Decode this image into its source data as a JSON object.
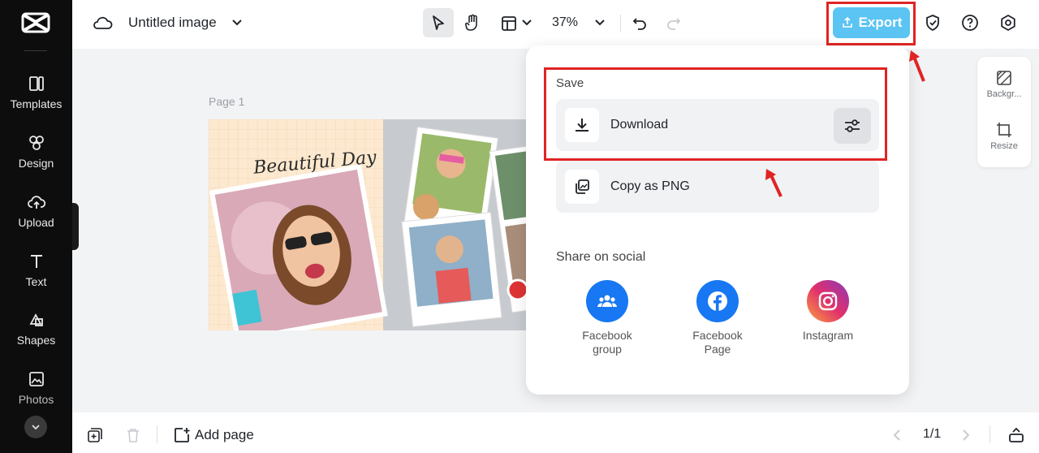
{
  "topbar": {
    "doc_title": "Untitled image",
    "zoom": "37%",
    "export_label": "Export"
  },
  "sidebar": {
    "items": [
      {
        "label": "Templates",
        "icon": "templates-icon"
      },
      {
        "label": "Design",
        "icon": "design-icon"
      },
      {
        "label": "Upload",
        "icon": "upload-cloud-icon"
      },
      {
        "label": "Text",
        "icon": "text-icon"
      },
      {
        "label": "Shapes",
        "icon": "shapes-icon"
      },
      {
        "label": "Photos",
        "icon": "photos-icon"
      }
    ]
  },
  "canvas": {
    "page_label": "Page 1",
    "artwork_text": "Beautiful Day"
  },
  "right_panel": {
    "items": [
      {
        "label": "Backgr...",
        "icon": "background-icon"
      },
      {
        "label": "Resize",
        "icon": "resize-icon"
      }
    ]
  },
  "export_menu": {
    "save_label": "Save",
    "download_label": "Download",
    "copy_label": "Copy as PNG",
    "share_label": "Share on social",
    "social": [
      {
        "label": "Facebook group",
        "color": "#1877f2",
        "icon": "facebook-group-icon"
      },
      {
        "label": "Facebook Page",
        "color": "#1877f2",
        "icon": "facebook-icon"
      },
      {
        "label": "Instagram",
        "color": "#e1306c",
        "icon": "instagram-icon"
      }
    ]
  },
  "bottombar": {
    "add_page_label": "Add page",
    "page_indicator": "1/1"
  },
  "colors": {
    "accent": "#5bc4f2",
    "highlight": "#e02424",
    "sidebar_bg": "#0d0d0d"
  }
}
